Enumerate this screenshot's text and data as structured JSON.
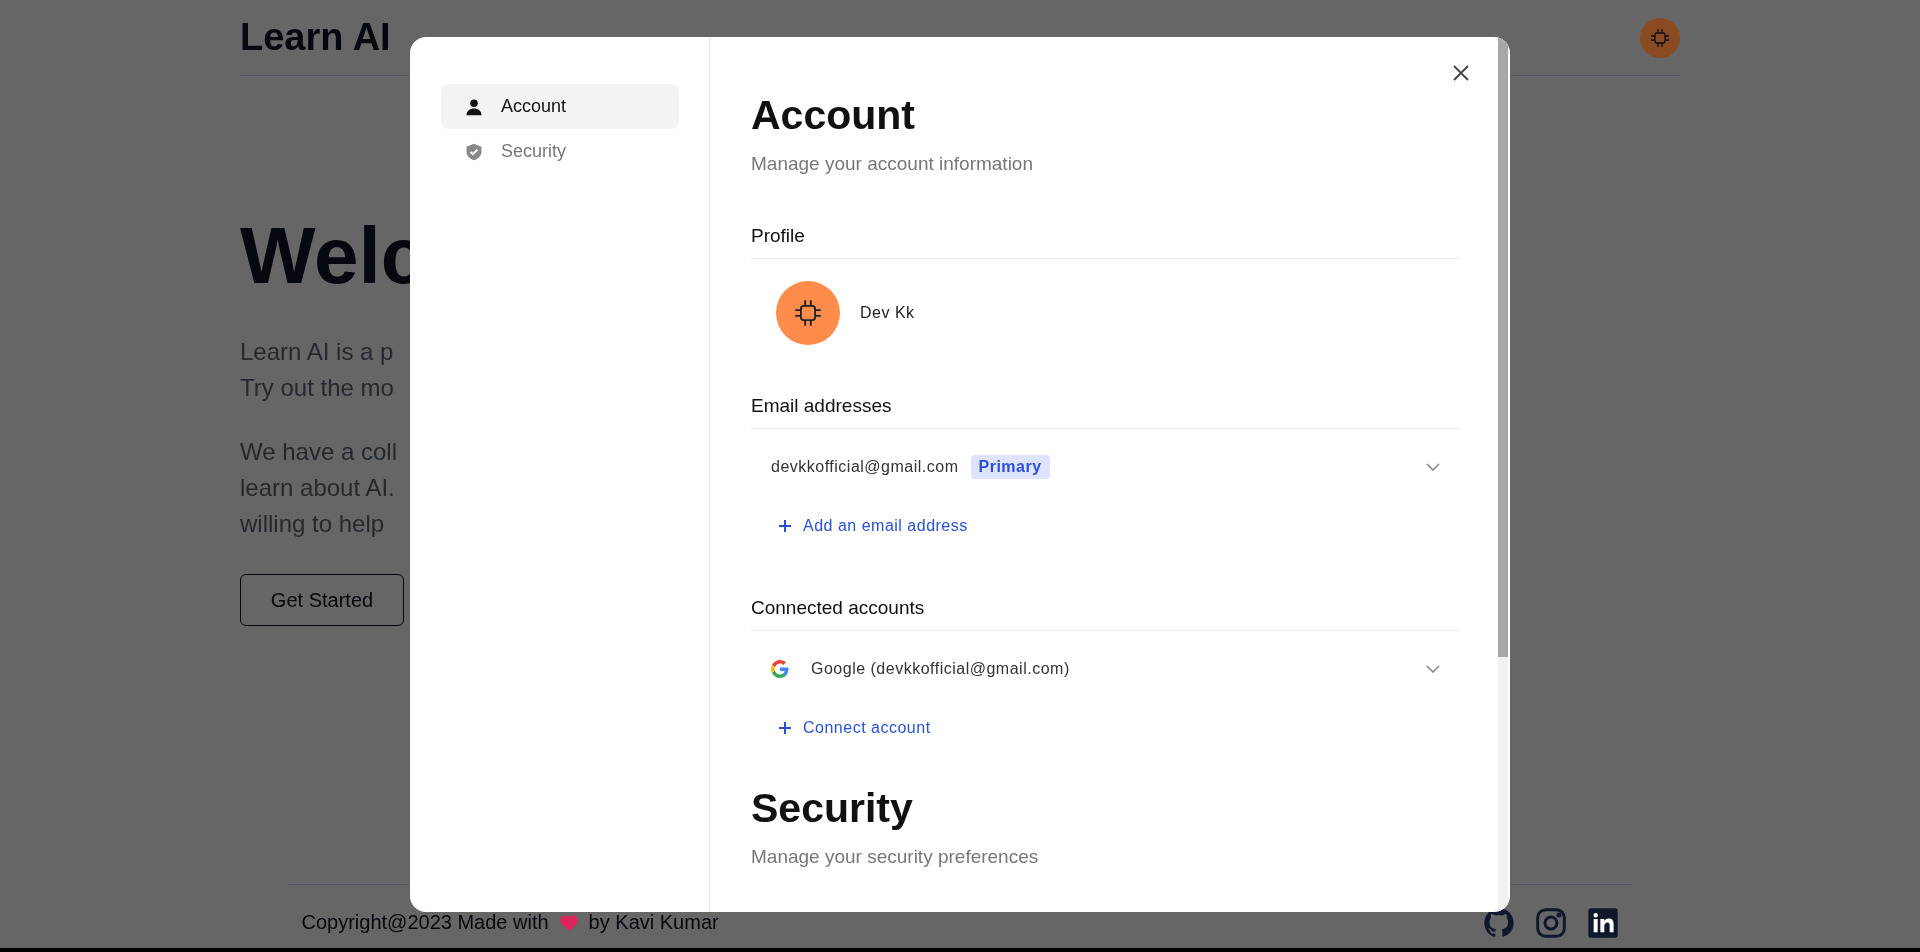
{
  "header": {
    "logo": "Learn AI"
  },
  "hero": {
    "title": "Welc",
    "paragraphs": [
      [
        "Learn AI is a p",
        "Try out the mo"
      ],
      [
        "We have a coll",
        "learn about AI.",
        "willing to help"
      ]
    ],
    "button": "Get Started"
  },
  "footer": {
    "credit_before": "Copyright@2023 Made with",
    "credit_after": "by Kavi Kumar"
  },
  "modal": {
    "sidebar": [
      {
        "label": "Account",
        "selected": true
      },
      {
        "label": "Security",
        "selected": false
      }
    ],
    "sections": [
      {
        "title": "Account",
        "subtitle": "Manage your account information",
        "groups": [
          {
            "heading": "Profile",
            "kind": "profile",
            "name": "Dev Kk"
          },
          {
            "heading": "Email addresses",
            "kind": "list",
            "items": [
              {
                "kind": "email",
                "text": "devkkofficial@gmail.com",
                "badge": "Primary"
              }
            ],
            "action": "Add an email address"
          },
          {
            "heading": "Connected accounts",
            "kind": "list",
            "items": [
              {
                "kind": "connected",
                "text": "Google (devkkofficial@gmail.com)"
              }
            ],
            "action": "Connect account"
          }
        ]
      },
      {
        "title": "Security",
        "subtitle": "Manage your security preferences"
      }
    ]
  }
}
